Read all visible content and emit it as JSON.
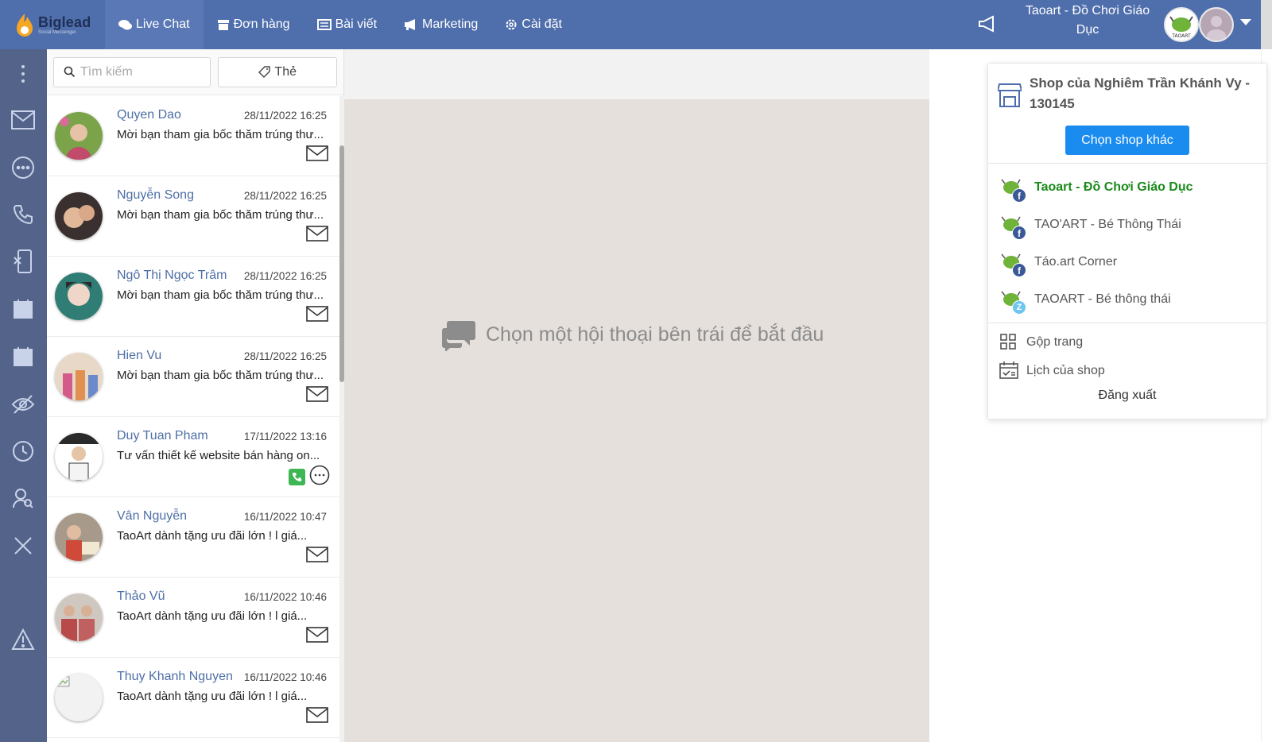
{
  "brand": {
    "name": "Biglead",
    "tagline": "Social Messenger"
  },
  "nav": [
    {
      "label": "Live Chat",
      "icon": "chat-icon",
      "active": true
    },
    {
      "label": "Đơn hàng",
      "icon": "box-icon"
    },
    {
      "label": "Bài viết",
      "icon": "newspaper-icon"
    },
    {
      "label": "Marketing",
      "icon": "megaphone-icon"
    },
    {
      "label": "Cài đặt",
      "icon": "gear-icon"
    }
  ],
  "header": {
    "shop_title": "Taoart - Đồ Chơi Giáo Dục"
  },
  "search": {
    "placeholder": "Tìm kiếm",
    "tag_label": "Thẻ"
  },
  "conversations": [
    {
      "name": "Quyen Dao",
      "time": "28/11/2022 16:25",
      "message": "Mời bạn tham gia bốc thăm trúng thư...",
      "channel": "mail"
    },
    {
      "name": "Nguyễn Song",
      "time": "28/11/2022 16:25",
      "message": "Mời bạn tham gia bốc thăm trúng thư...",
      "channel": "mail"
    },
    {
      "name": "Ngô Thị Ngọc Trâm",
      "time": "28/11/2022 16:25",
      "message": "Mời bạn tham gia bốc thăm trúng thư...",
      "channel": "mail"
    },
    {
      "name": "Hien Vu",
      "time": "28/11/2022 16:25",
      "message": "Mời bạn tham gia bốc thăm trúng thư...",
      "channel": "mail"
    },
    {
      "name": "Duy Tuan Pham",
      "time": "17/11/2022 13:16",
      "message": "Tư vấn thiết kế website bán hàng on...",
      "channel": "phone-chat"
    },
    {
      "name": "Vân Nguyễn",
      "time": "16/11/2022 10:47",
      "message": "TaoArt dành tặng ưu đãi lớn ! l giá...",
      "channel": "mail"
    },
    {
      "name": "Thảo Vũ",
      "time": "16/11/2022 10:46",
      "message": "TaoArt dành tặng ưu đãi lớn ! l giá...",
      "channel": "mail"
    },
    {
      "name": "Thuy Khanh Nguyen",
      "time": "16/11/2022 10:46",
      "message": "TaoArt dành tặng ưu đãi lớn ! l giá...",
      "channel": "mail"
    }
  ],
  "main": {
    "placeholder": "Chọn một hội thoại bên trái để bắt đầu"
  },
  "dropdown": {
    "shop_name": "Shop của Nghiêm Trần Khánh Vy - 130145",
    "choose_label": "Chọn shop khác",
    "pages": [
      {
        "name": "Taoart - Đồ Chơi Giáo Dục",
        "platform": "facebook",
        "active": true
      },
      {
        "name": "TAO'ART - Bé Thông Thái",
        "platform": "facebook"
      },
      {
        "name": "Táo.art Corner",
        "platform": "facebook"
      },
      {
        "name": "TAOART - Bé thông thái",
        "platform": "zalo"
      }
    ],
    "merge_label": "Gộp trang",
    "calendar_label": "Lịch của shop",
    "logout_label": "Đăng xuất"
  },
  "colors": {
    "topbar": "#4f6eac",
    "rail": "#54638a",
    "accent": "#1a8cf0",
    "active_page": "#1a8a1a"
  }
}
